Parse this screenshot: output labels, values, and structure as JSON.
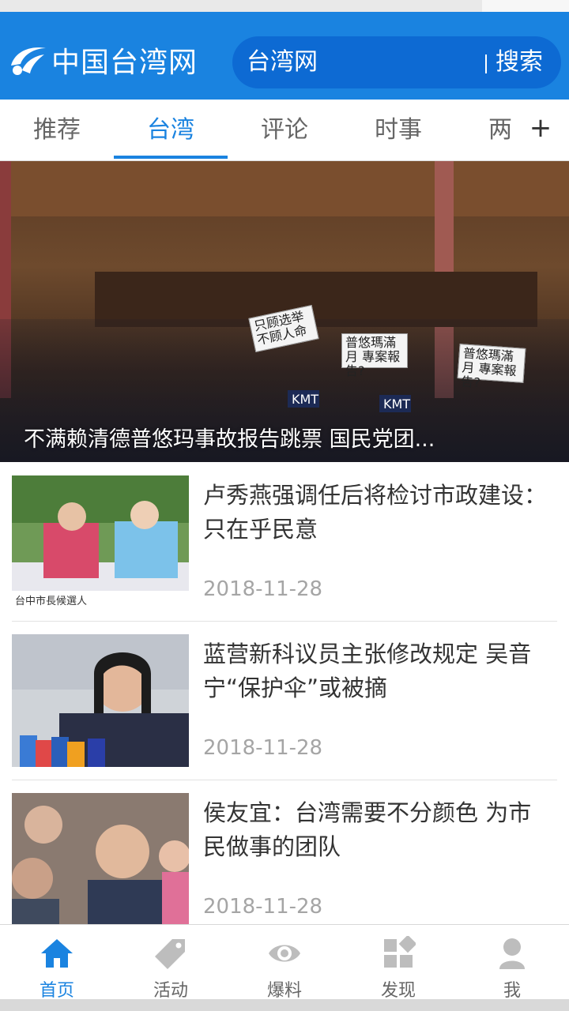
{
  "header": {
    "logo_text": "中国台湾网",
    "search_value": "台湾网",
    "search_button": "搜索"
  },
  "tabs": [
    {
      "label": "推荐",
      "active": false
    },
    {
      "label": "台湾",
      "active": true
    },
    {
      "label": "评论",
      "active": false
    },
    {
      "label": "时事",
      "active": false
    },
    {
      "label": "两岸",
      "active": false
    }
  ],
  "tabs_more_icon": "plus-icon",
  "hero": {
    "caption": "不满赖清德普悠玛事故报告跳票 国民党团...",
    "signs": [
      "只顾选举 不顾人命",
      "普悠瑪滿月 專案報告?",
      "普悠瑪滿月 專案報告?",
      "KMT",
      "KMT"
    ]
  },
  "news": [
    {
      "title": "卢秀燕强调任后将检讨市政建设：只在乎民意",
      "date": "2018-11-28",
      "thumb_caption": "台中市長候選人"
    },
    {
      "title": "蓝营新科议员主张修改规定 吴音宁“保护伞”或被摘",
      "date": "2018-11-28"
    },
    {
      "title": "侯友宜：台湾需要不分颜色 为市民做事的团队",
      "date": "2018-11-28"
    }
  ],
  "tabbar": [
    {
      "label": "首页",
      "icon": "home-icon",
      "active": true
    },
    {
      "label": "活动",
      "icon": "tag-icon",
      "active": false
    },
    {
      "label": "爆料",
      "icon": "eye-icon",
      "active": false
    },
    {
      "label": "发现",
      "icon": "apps-icon",
      "active": false
    },
    {
      "label": "我",
      "icon": "user-icon",
      "active": false
    }
  ],
  "colors": {
    "brand_blue": "#1a83e0",
    "search_blue": "#0d6ad3",
    "date_gray": "#a5a5a5"
  }
}
